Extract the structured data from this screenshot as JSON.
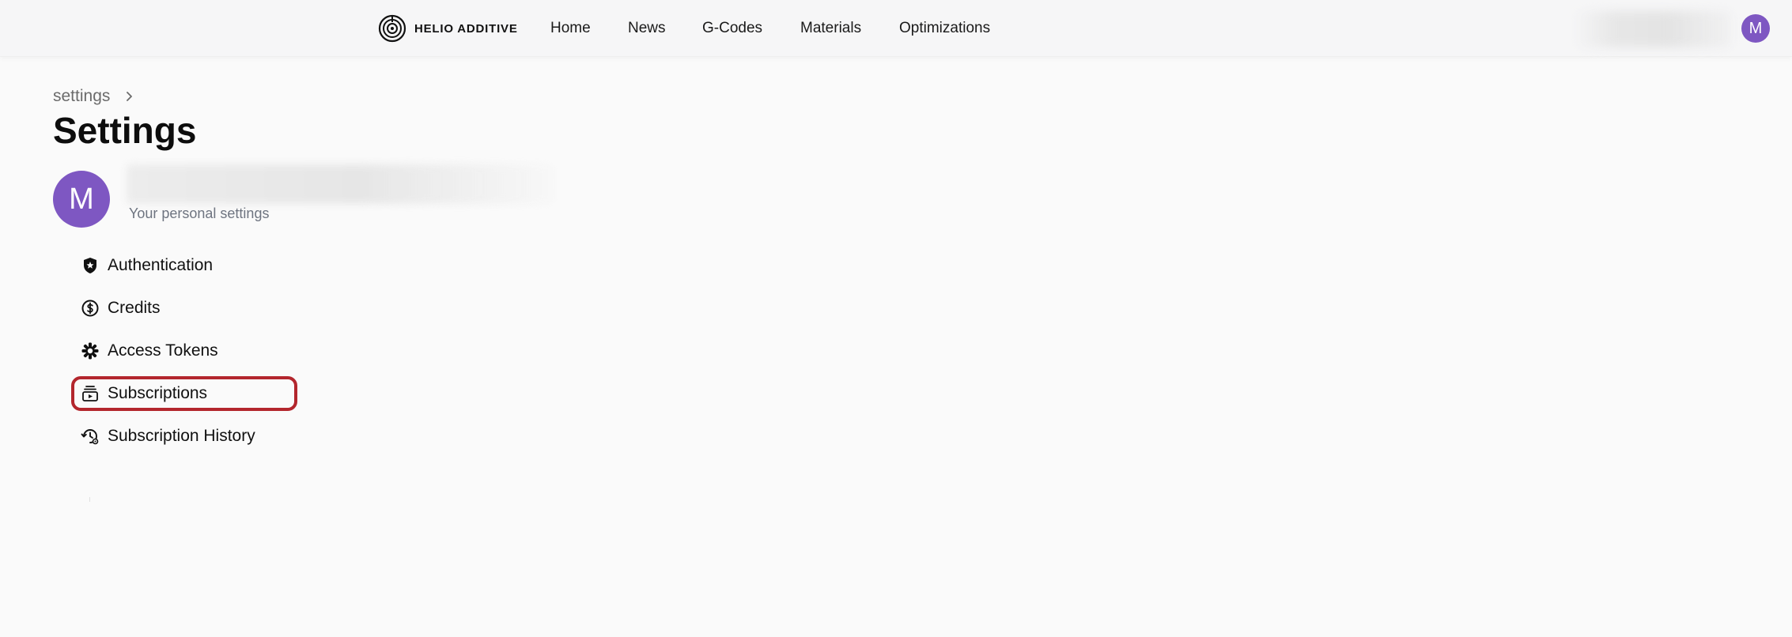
{
  "header": {
    "brand": "HELIO ADDITIVE",
    "nav": [
      "Home",
      "News",
      "G-Codes",
      "Materials",
      "Optimizations"
    ],
    "avatar_initial": "M"
  },
  "breadcrumb": {
    "items": [
      "settings"
    ]
  },
  "page": {
    "title": "Settings"
  },
  "profile": {
    "avatar_initial": "M",
    "subtitle": "Your personal settings"
  },
  "menu": {
    "items": [
      {
        "label": "Authentication",
        "icon": "shield-star-icon"
      },
      {
        "label": "Credits",
        "icon": "dollar-coin-icon"
      },
      {
        "label": "Access Tokens",
        "icon": "asterisk-gear-icon"
      },
      {
        "label": "Subscriptions",
        "icon": "subscriptions-icon"
      },
      {
        "label": "Subscription History",
        "icon": "history-icon"
      }
    ],
    "highlighted": "Subscriptions"
  },
  "colors": {
    "avatar": "#7e57c2",
    "highlight_border": "#b3262d",
    "background": "#fafafa"
  }
}
